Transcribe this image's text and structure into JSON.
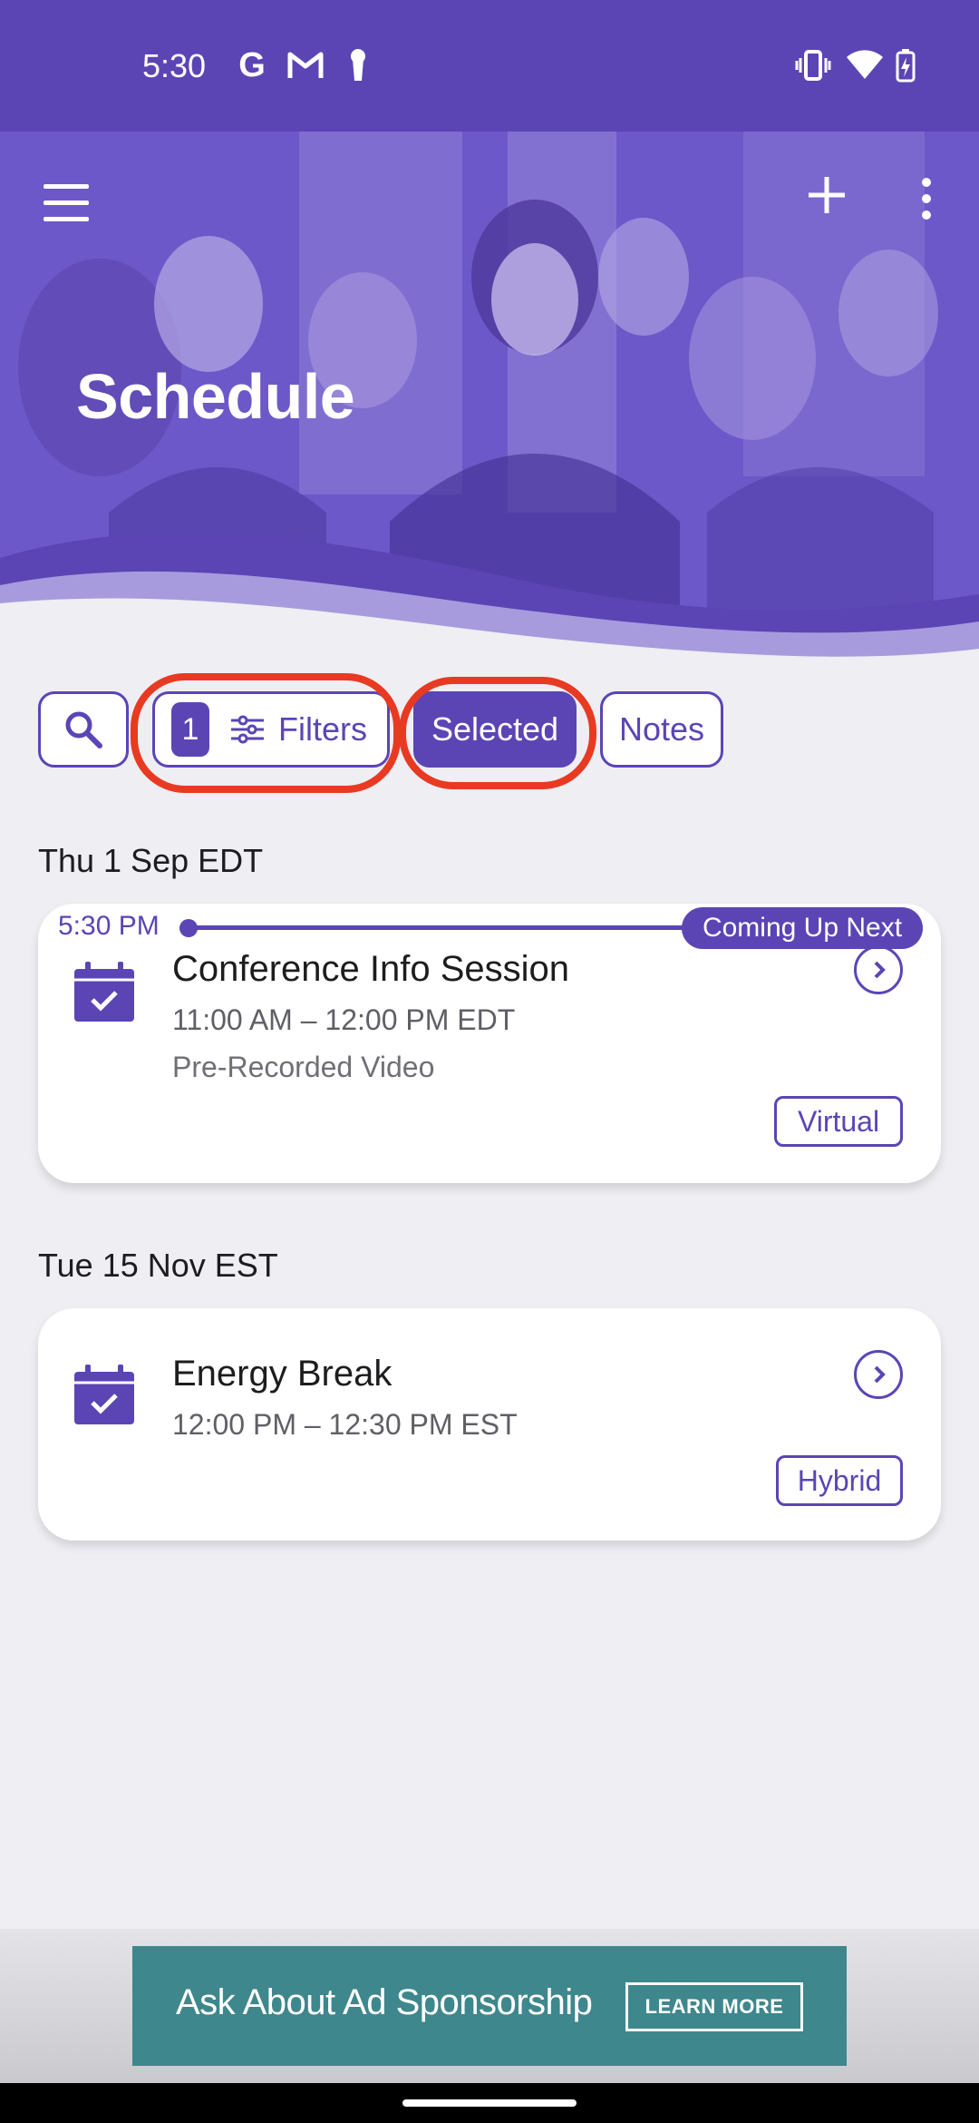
{
  "status_bar": {
    "time": "5:30",
    "left_icons": [
      "google-icon",
      "gmail-icon",
      "keyhole-icon"
    ],
    "right_icons": [
      "vibrate-icon",
      "wifi-icon",
      "battery-charging-icon"
    ]
  },
  "header": {
    "title": "Schedule",
    "menu_icon": "hamburger-menu-icon",
    "add_icon": "plus-icon",
    "more_icon": "more-vertical-icon"
  },
  "toolbar": {
    "search_icon": "search-icon",
    "filter_count": "1",
    "filters_label": "Filters",
    "selected_label": "Selected",
    "notes_label": "Notes"
  },
  "days": [
    {
      "date_label": "Thu 1 Sep EDT",
      "now_indicator": {
        "time": "5:30 PM",
        "label": "Coming Up Next"
      },
      "sessions": [
        {
          "title": "Conference Info Session",
          "time": "11:00 AM – 12:00 PM EDT",
          "subtitle": "Pre-Recorded Video",
          "badge": "Virtual"
        }
      ]
    },
    {
      "date_label": "Tue 15 Nov EST",
      "sessions": [
        {
          "title": "Energy Break",
          "time": "12:00 PM – 12:30 PM EST",
          "badge": "Hybrid"
        }
      ]
    }
  ],
  "ad": {
    "text": "Ask About Ad Sponsorship",
    "button": "LEARN MORE"
  },
  "colors": {
    "primary": "#5B45B5",
    "background": "#EEEEF3",
    "highlight_ring": "#E83A22",
    "ad_background": "#3E878C"
  }
}
